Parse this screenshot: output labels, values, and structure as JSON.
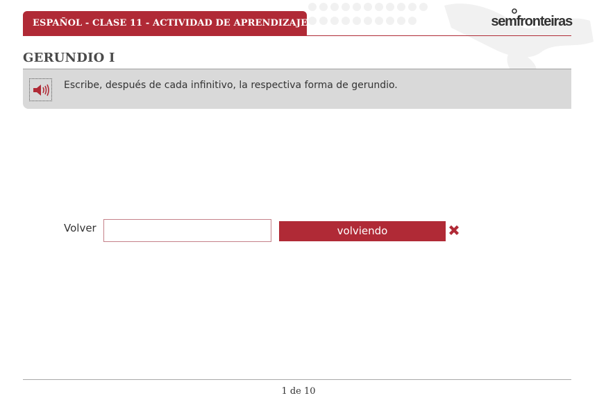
{
  "header": {
    "course_label": "ESPAÑOL - CLASE 11 - ACTIVIDAD DE APRENDIZAJE",
    "brand_name": "semfronteiras",
    "brand_color": "#b02a36"
  },
  "activity": {
    "title": "GERUNDIO I",
    "instruction": "Escribe, después de cada infinitivo, la respectiva forma de gerundio.",
    "audio_icon": "speaker-icon"
  },
  "exercise": {
    "infinitive": "Volver",
    "answer_value": "",
    "correct_answer": "volviendo",
    "result_icon": "cross-icon",
    "result_color": "#b02a36"
  },
  "pagination": {
    "label": "1 de 10"
  }
}
